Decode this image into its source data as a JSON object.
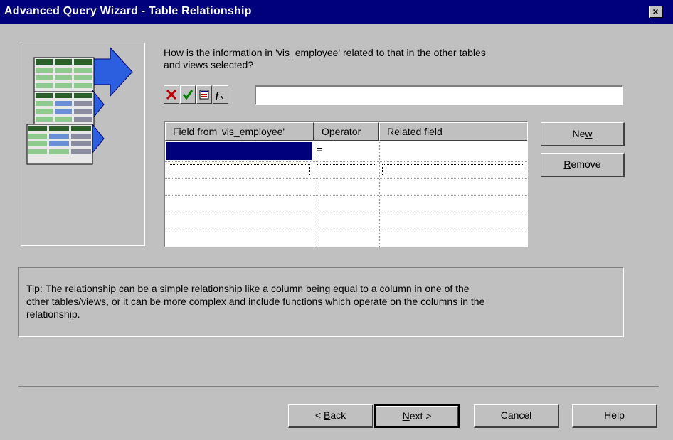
{
  "window": {
    "title": "Advanced Query Wizard - Table Relationship",
    "close_label": "×"
  },
  "question": {
    "line1": "How is the information in 'vis_employee' related to that in the other tables",
    "line2": "and views selected?"
  },
  "toolbar": {
    "icons": [
      "cancel-x-icon",
      "accept-check-icon",
      "list-icon",
      "function-icon"
    ],
    "expression_value": ""
  },
  "grid": {
    "columns": [
      "Field from 'vis_employee'",
      "Operator",
      "Related field"
    ],
    "rows": [
      {
        "field": "",
        "operator": "=",
        "related": ""
      },
      {
        "field": "",
        "operator": "",
        "related": ""
      }
    ]
  },
  "buttons": {
    "new": {
      "pre": "Ne",
      "key": "w",
      "post": ""
    },
    "remove": {
      "pre": "",
      "key": "R",
      "post": "emove"
    },
    "back": {
      "pre": "< ",
      "key": "B",
      "post": "ack"
    },
    "next": {
      "pre": "",
      "key": "N",
      "post": "ext >"
    },
    "cancel": "Cancel",
    "help": "Help"
  },
  "tip": {
    "line1": "Tip: The relationship can be a simple relationship like a column being equal to a column in one of the",
    "line2": "other tables/views, or it can be more complex and include functions which operate on the columns in the",
    "line3": "relationship."
  },
  "colors": {
    "title_bar": "#00007c",
    "dialog_bg": "#c0c0c0",
    "selection": "#00007c"
  }
}
